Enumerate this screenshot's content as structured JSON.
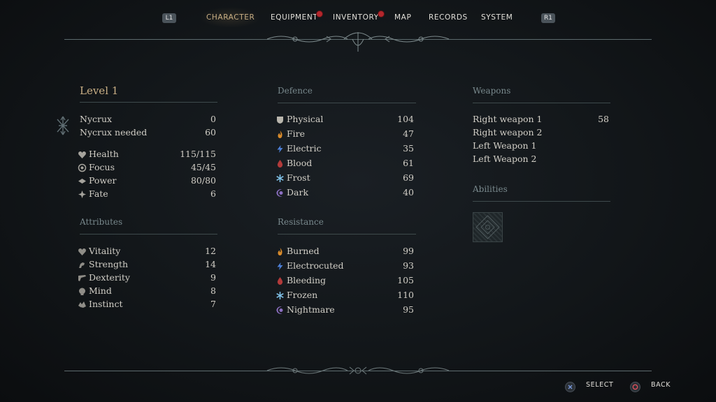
{
  "nav": {
    "left_button": "L1",
    "right_button": "R1",
    "tabs": [
      {
        "label": "CHARACTER",
        "active": true,
        "badge": false
      },
      {
        "label": "EQUIPMENT",
        "active": false,
        "badge": true
      },
      {
        "label": "INVENTORY",
        "active": false,
        "badge": true
      },
      {
        "label": "MAP",
        "active": false,
        "badge": false
      },
      {
        "label": "RECORDS",
        "active": false,
        "badge": false
      },
      {
        "label": "SYSTEM",
        "active": false,
        "badge": false
      }
    ]
  },
  "character": {
    "level_title": "Level 1",
    "nycrux": [
      {
        "label": "Nycrux",
        "value": "0"
      },
      {
        "label": "Nycrux needed",
        "value": "60"
      }
    ],
    "stats": [
      {
        "label": "Health",
        "value": "115/115",
        "icon": "health-icon"
      },
      {
        "label": "Focus",
        "value": "45/45",
        "icon": "focus-icon"
      },
      {
        "label": "Power",
        "value": "80/80",
        "icon": "power-icon"
      },
      {
        "label": "Fate",
        "value": "6",
        "icon": "fate-icon"
      }
    ],
    "attributes_title": "Attributes",
    "attributes": [
      {
        "label": "Vitality",
        "value": "12",
        "icon": "vitality-icon"
      },
      {
        "label": "Strength",
        "value": "14",
        "icon": "strength-icon"
      },
      {
        "label": "Dexterity",
        "value": "9",
        "icon": "dexterity-icon"
      },
      {
        "label": "Mind",
        "value": "8",
        "icon": "mind-icon"
      },
      {
        "label": "Instinct",
        "value": "7",
        "icon": "instinct-icon"
      }
    ]
  },
  "defence": {
    "title": "Defence",
    "items": [
      {
        "label": "Physical",
        "value": "104",
        "icon": "physical-icon",
        "color": "#b9b6ad"
      },
      {
        "label": "Fire",
        "value": "47",
        "icon": "fire-icon",
        "color": "#d98b2b"
      },
      {
        "label": "Electric",
        "value": "35",
        "icon": "electric-icon",
        "color": "#4c7fd6"
      },
      {
        "label": "Blood",
        "value": "61",
        "icon": "blood-icon",
        "color": "#b23a3a"
      },
      {
        "label": "Frost",
        "value": "69",
        "icon": "frost-icon",
        "color": "#7fc0e6"
      },
      {
        "label": "Dark",
        "value": "40",
        "icon": "dark-icon",
        "color": "#8c6fc2"
      }
    ]
  },
  "resistance": {
    "title": "Resistance",
    "items": [
      {
        "label": "Burned",
        "value": "99",
        "icon": "burned-icon",
        "color": "#d98b2b"
      },
      {
        "label": "Electrocuted",
        "value": "93",
        "icon": "electrocuted-icon",
        "color": "#4c7fd6"
      },
      {
        "label": "Bleeding",
        "value": "105",
        "icon": "bleeding-icon",
        "color": "#b23a3a"
      },
      {
        "label": "Frozen",
        "value": "110",
        "icon": "frozen-icon",
        "color": "#7fc0e6"
      },
      {
        "label": "Nightmare",
        "value": "95",
        "icon": "nightmare-icon",
        "color": "#8c6fc2"
      }
    ]
  },
  "weapons": {
    "title": "Weapons",
    "items": [
      {
        "label": "Right weapon 1",
        "value": "58"
      },
      {
        "label": "Right weapon 2",
        "value": ""
      },
      {
        "label": "Left Weapon 1",
        "value": ""
      },
      {
        "label": "Left Weapon 2",
        "value": ""
      }
    ]
  },
  "abilities": {
    "title": "Abilities"
  },
  "footer": {
    "select_label": "SELECT",
    "back_label": "BACK"
  }
}
